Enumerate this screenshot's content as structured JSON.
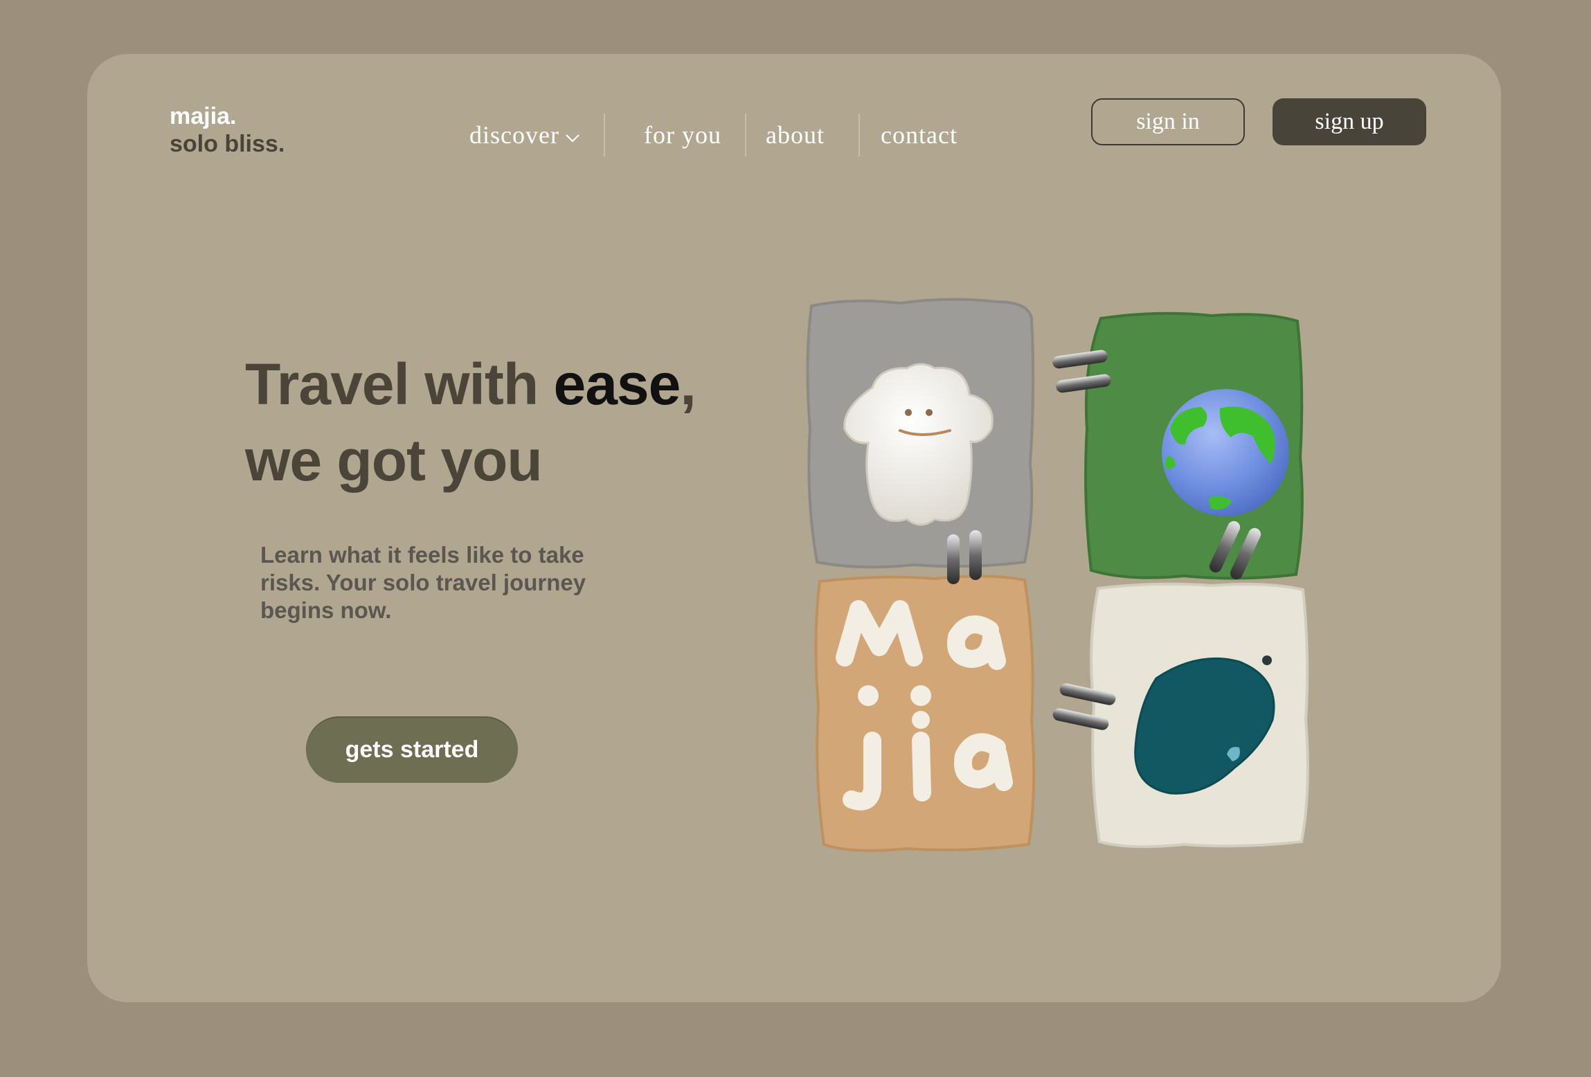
{
  "brand": {
    "name": "majia.",
    "tagline": "solo bliss."
  },
  "nav": {
    "items": [
      {
        "label": "discover",
        "has_dropdown": true,
        "icon": "chevron-down-icon"
      },
      {
        "label": "for you"
      },
      {
        "label": "about"
      },
      {
        "label": "contact"
      }
    ]
  },
  "auth": {
    "sign_in": "sign in",
    "sign_up": "sign up"
  },
  "hero": {
    "headline_part1": "Travel with ",
    "headline_emphasis": "ease",
    "headline_part2": ",",
    "headline_line2": "we got you",
    "subtitle": "Learn what it feels like to take risks. Your solo travel journey begins now.",
    "cta": "gets started"
  },
  "illustration": {
    "tiles": [
      "ghost-tile",
      "globe-tile",
      "majia-letters-tile",
      "blob-tile"
    ],
    "letters": "Ma:jia"
  },
  "colors": {
    "page_bg": "#9c8f7b",
    "card_bg": "#b1a690",
    "accent_dark": "#48443a",
    "cta_bg": "#6e6e53",
    "tile_gray": "#9b9a97",
    "tile_green": "#4d8a44",
    "tile_tan": "#d2a575",
    "tile_cream": "#e7e3d7"
  }
}
